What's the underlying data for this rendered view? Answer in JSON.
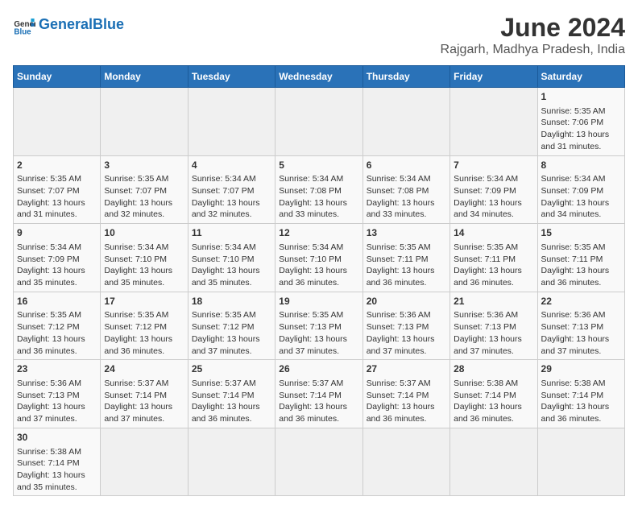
{
  "header": {
    "logo_general": "General",
    "logo_blue": "Blue",
    "title": "June 2024",
    "subtitle": "Rajgarh, Madhya Pradesh, India"
  },
  "weekdays": [
    "Sunday",
    "Monday",
    "Tuesday",
    "Wednesday",
    "Thursday",
    "Friday",
    "Saturday"
  ],
  "weeks": [
    [
      {
        "day": "",
        "info": ""
      },
      {
        "day": "",
        "info": ""
      },
      {
        "day": "",
        "info": ""
      },
      {
        "day": "",
        "info": ""
      },
      {
        "day": "",
        "info": ""
      },
      {
        "day": "",
        "info": ""
      },
      {
        "day": "1",
        "info": "Sunrise: 5:35 AM\nSunset: 7:06 PM\nDaylight: 13 hours and 31 minutes."
      }
    ],
    [
      {
        "day": "2",
        "info": "Sunrise: 5:35 AM\nSunset: 7:07 PM\nDaylight: 13 hours and 31 minutes."
      },
      {
        "day": "3",
        "info": "Sunrise: 5:35 AM\nSunset: 7:07 PM\nDaylight: 13 hours and 32 minutes."
      },
      {
        "day": "4",
        "info": "Sunrise: 5:34 AM\nSunset: 7:07 PM\nDaylight: 13 hours and 32 minutes."
      },
      {
        "day": "5",
        "info": "Sunrise: 5:34 AM\nSunset: 7:08 PM\nDaylight: 13 hours and 33 minutes."
      },
      {
        "day": "6",
        "info": "Sunrise: 5:34 AM\nSunset: 7:08 PM\nDaylight: 13 hours and 33 minutes."
      },
      {
        "day": "7",
        "info": "Sunrise: 5:34 AM\nSunset: 7:09 PM\nDaylight: 13 hours and 34 minutes."
      },
      {
        "day": "8",
        "info": "Sunrise: 5:34 AM\nSunset: 7:09 PM\nDaylight: 13 hours and 34 minutes."
      }
    ],
    [
      {
        "day": "9",
        "info": "Sunrise: 5:34 AM\nSunset: 7:09 PM\nDaylight: 13 hours and 35 minutes."
      },
      {
        "day": "10",
        "info": "Sunrise: 5:34 AM\nSunset: 7:10 PM\nDaylight: 13 hours and 35 minutes."
      },
      {
        "day": "11",
        "info": "Sunrise: 5:34 AM\nSunset: 7:10 PM\nDaylight: 13 hours and 35 minutes."
      },
      {
        "day": "12",
        "info": "Sunrise: 5:34 AM\nSunset: 7:10 PM\nDaylight: 13 hours and 36 minutes."
      },
      {
        "day": "13",
        "info": "Sunrise: 5:35 AM\nSunset: 7:11 PM\nDaylight: 13 hours and 36 minutes."
      },
      {
        "day": "14",
        "info": "Sunrise: 5:35 AM\nSunset: 7:11 PM\nDaylight: 13 hours and 36 minutes."
      },
      {
        "day": "15",
        "info": "Sunrise: 5:35 AM\nSunset: 7:11 PM\nDaylight: 13 hours and 36 minutes."
      }
    ],
    [
      {
        "day": "16",
        "info": "Sunrise: 5:35 AM\nSunset: 7:12 PM\nDaylight: 13 hours and 36 minutes."
      },
      {
        "day": "17",
        "info": "Sunrise: 5:35 AM\nSunset: 7:12 PM\nDaylight: 13 hours and 36 minutes."
      },
      {
        "day": "18",
        "info": "Sunrise: 5:35 AM\nSunset: 7:12 PM\nDaylight: 13 hours and 37 minutes."
      },
      {
        "day": "19",
        "info": "Sunrise: 5:35 AM\nSunset: 7:13 PM\nDaylight: 13 hours and 37 minutes."
      },
      {
        "day": "20",
        "info": "Sunrise: 5:36 AM\nSunset: 7:13 PM\nDaylight: 13 hours and 37 minutes."
      },
      {
        "day": "21",
        "info": "Sunrise: 5:36 AM\nSunset: 7:13 PM\nDaylight: 13 hours and 37 minutes."
      },
      {
        "day": "22",
        "info": "Sunrise: 5:36 AM\nSunset: 7:13 PM\nDaylight: 13 hours and 37 minutes."
      }
    ],
    [
      {
        "day": "23",
        "info": "Sunrise: 5:36 AM\nSunset: 7:13 PM\nDaylight: 13 hours and 37 minutes."
      },
      {
        "day": "24",
        "info": "Sunrise: 5:37 AM\nSunset: 7:14 PM\nDaylight: 13 hours and 37 minutes."
      },
      {
        "day": "25",
        "info": "Sunrise: 5:37 AM\nSunset: 7:14 PM\nDaylight: 13 hours and 36 minutes."
      },
      {
        "day": "26",
        "info": "Sunrise: 5:37 AM\nSunset: 7:14 PM\nDaylight: 13 hours and 36 minutes."
      },
      {
        "day": "27",
        "info": "Sunrise: 5:37 AM\nSunset: 7:14 PM\nDaylight: 13 hours and 36 minutes."
      },
      {
        "day": "28",
        "info": "Sunrise: 5:38 AM\nSunset: 7:14 PM\nDaylight: 13 hours and 36 minutes."
      },
      {
        "day": "29",
        "info": "Sunrise: 5:38 AM\nSunset: 7:14 PM\nDaylight: 13 hours and 36 minutes."
      }
    ],
    [
      {
        "day": "30",
        "info": "Sunrise: 5:38 AM\nSunset: 7:14 PM\nDaylight: 13 hours and 35 minutes."
      },
      {
        "day": "",
        "info": ""
      },
      {
        "day": "",
        "info": ""
      },
      {
        "day": "",
        "info": ""
      },
      {
        "day": "",
        "info": ""
      },
      {
        "day": "",
        "info": ""
      },
      {
        "day": "",
        "info": ""
      }
    ]
  ]
}
